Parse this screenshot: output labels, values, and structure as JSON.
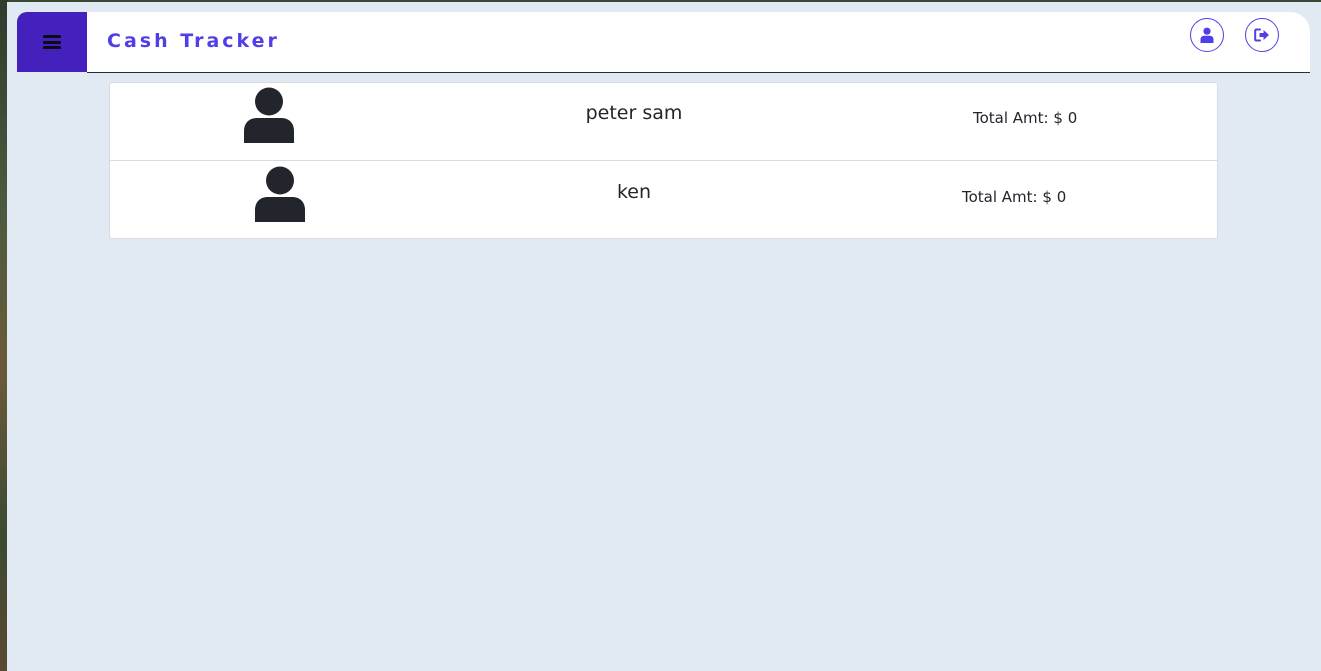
{
  "app": {
    "title": "Cash Tracker",
    "accent_color": "#4f3fe6",
    "menu_color": "#4421bd",
    "background_color": "#e1eaf3"
  },
  "header": {
    "menu_icon": "hamburger-menu-icon",
    "profile_icon": "user-icon",
    "logout_icon": "sign-out-icon"
  },
  "people": [
    {
      "name": "peter sam",
      "total": "Total Amt: $ 0",
      "icon": "user-avatar-icon"
    },
    {
      "name": "ken",
      "total": "Total Amt: $ 0",
      "icon": "user-avatar-icon"
    }
  ]
}
